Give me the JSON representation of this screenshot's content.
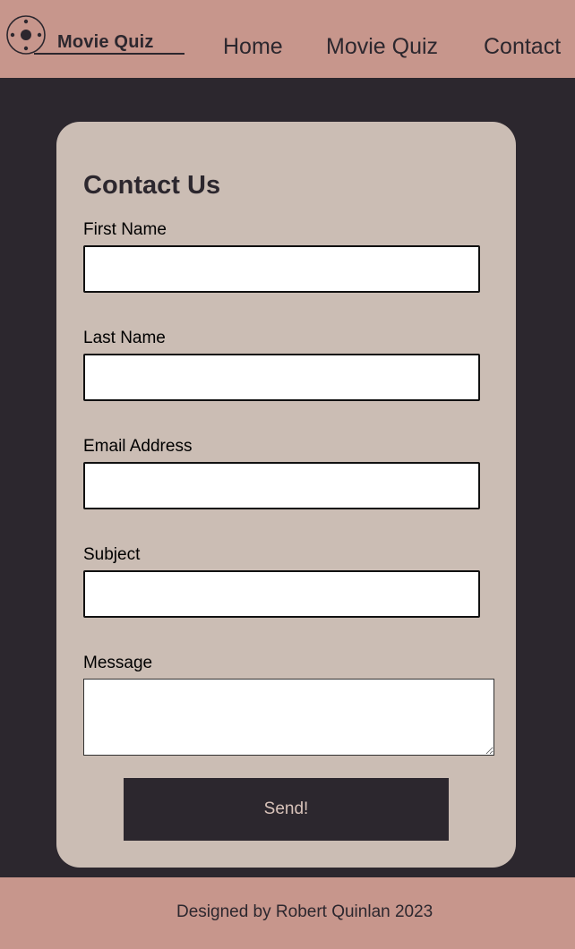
{
  "header": {
    "logo_text": "Movie Quiz",
    "nav": [
      {
        "label": "Home"
      },
      {
        "label": "Movie Quiz"
      },
      {
        "label": "Contact"
      }
    ]
  },
  "form": {
    "title": "Contact Us",
    "fields": [
      {
        "label": "First Name",
        "value": ""
      },
      {
        "label": "Last Name",
        "value": ""
      },
      {
        "label": "Email Address",
        "value": ""
      },
      {
        "label": "Subject",
        "value": ""
      },
      {
        "label": "Message",
        "value": ""
      }
    ],
    "submit_label": "Send!"
  },
  "footer": {
    "text": "Designed by Robert Quinlan 2023"
  },
  "colors": {
    "header_bg": "#c7968c",
    "page_bg": "#2c272e",
    "card_bg": "#cbbdb4",
    "button_bg": "#2c272e",
    "button_text": "#d9c3ba"
  },
  "icons": {
    "logo": "film-reel-icon"
  }
}
